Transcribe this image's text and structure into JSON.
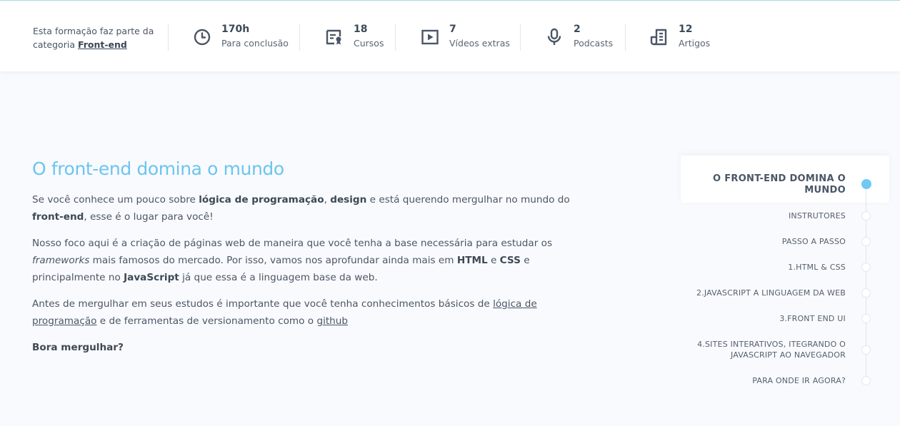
{
  "stats_bar": {
    "category_text_pre": "Esta formação faz parte da categoria",
    "category_link": "Front-end",
    "items": [
      {
        "icon": "clock-icon",
        "value": "170h",
        "label": "Para conclusão"
      },
      {
        "icon": "course-certificate-icon",
        "value": "18",
        "label": "Cursos"
      },
      {
        "icon": "video-play-icon",
        "value": "7",
        "label": "Vídeos extras"
      },
      {
        "icon": "microphone-icon",
        "value": "2",
        "label": "Podcasts"
      },
      {
        "icon": "article-icon",
        "value": "12",
        "label": "Artigos"
      }
    ]
  },
  "main": {
    "title": "O front-end domina o mundo",
    "p1": {
      "t1": "Se você conhece um pouco sobre ",
      "b1": "lógica de programação",
      "t2": ", ",
      "b2": "design",
      "t3": " e está querendo mergulhar no mundo do ",
      "b3": "front-end",
      "t4": ", esse é o lugar para você!"
    },
    "p2": {
      "t1": "Nosso foco aqui é a criação de páginas web de maneira que você tenha a base necessária para estudar os ",
      "i1": "frameworks",
      "t2": " mais famosos do mercado. Por isso, vamos nos aprofundar ainda mais em ",
      "b1": "HTML",
      "t3": " e ",
      "b2": "CSS",
      "t4": " e principalmente no ",
      "b3": "JavaScript",
      "t5": " já que essa é a linguagem base da web."
    },
    "p3": {
      "t1": "Antes de mergulhar em seus estudos é importante que você tenha conhecimentos básicos de ",
      "link1": "lógica de programação",
      "t2": " e de ferramentas de versionamento como o ",
      "link2": "github"
    },
    "p4": "Bora mergulhar?"
  },
  "index": {
    "items": [
      {
        "label_line1": "O FRONT-END DOMINA O",
        "label_line2": "MUNDO",
        "active": true
      },
      {
        "label": "INSTRUTORES"
      },
      {
        "label": "PASSO A PASSO"
      },
      {
        "label": "1.HTML & CSS"
      },
      {
        "label": "2.JAVASCRIPT A LINGUAGEM DA WEB"
      },
      {
        "label": "3.FRONT END UI"
      },
      {
        "label_line1": "4.SITES INTERATIVOS, ITEGRANDO O",
        "label_line2": "JAVASCRIPT AO NAVEGADOR"
      },
      {
        "label": "PARA ONDE IR AGORA?"
      }
    ]
  },
  "colors": {
    "accent": "#6bc5f0",
    "text": "#4a5666",
    "background": "#f9fafd"
  }
}
